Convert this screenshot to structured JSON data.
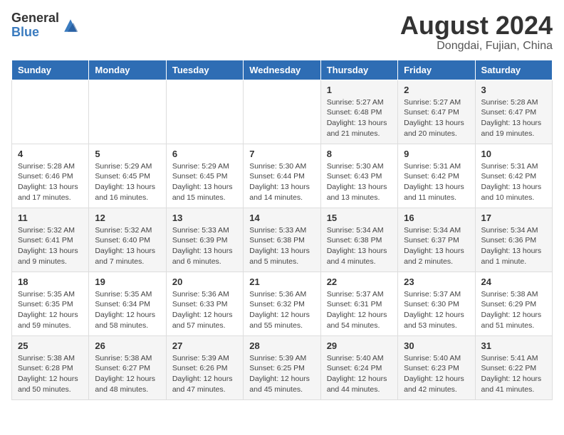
{
  "header": {
    "logo_general": "General",
    "logo_blue": "Blue",
    "month_title": "August 2024",
    "location": "Dongdai, Fujian, China"
  },
  "weekdays": [
    "Sunday",
    "Monday",
    "Tuesday",
    "Wednesday",
    "Thursday",
    "Friday",
    "Saturday"
  ],
  "weeks": [
    [
      {
        "day": "",
        "content": ""
      },
      {
        "day": "",
        "content": ""
      },
      {
        "day": "",
        "content": ""
      },
      {
        "day": "",
        "content": ""
      },
      {
        "day": "1",
        "content": "Sunrise: 5:27 AM\nSunset: 6:48 PM\nDaylight: 13 hours\nand 21 minutes."
      },
      {
        "day": "2",
        "content": "Sunrise: 5:27 AM\nSunset: 6:47 PM\nDaylight: 13 hours\nand 20 minutes."
      },
      {
        "day": "3",
        "content": "Sunrise: 5:28 AM\nSunset: 6:47 PM\nDaylight: 13 hours\nand 19 minutes."
      }
    ],
    [
      {
        "day": "4",
        "content": "Sunrise: 5:28 AM\nSunset: 6:46 PM\nDaylight: 13 hours\nand 17 minutes."
      },
      {
        "day": "5",
        "content": "Sunrise: 5:29 AM\nSunset: 6:45 PM\nDaylight: 13 hours\nand 16 minutes."
      },
      {
        "day": "6",
        "content": "Sunrise: 5:29 AM\nSunset: 6:45 PM\nDaylight: 13 hours\nand 15 minutes."
      },
      {
        "day": "7",
        "content": "Sunrise: 5:30 AM\nSunset: 6:44 PM\nDaylight: 13 hours\nand 14 minutes."
      },
      {
        "day": "8",
        "content": "Sunrise: 5:30 AM\nSunset: 6:43 PM\nDaylight: 13 hours\nand 13 minutes."
      },
      {
        "day": "9",
        "content": "Sunrise: 5:31 AM\nSunset: 6:42 PM\nDaylight: 13 hours\nand 11 minutes."
      },
      {
        "day": "10",
        "content": "Sunrise: 5:31 AM\nSunset: 6:42 PM\nDaylight: 13 hours\nand 10 minutes."
      }
    ],
    [
      {
        "day": "11",
        "content": "Sunrise: 5:32 AM\nSunset: 6:41 PM\nDaylight: 13 hours\nand 9 minutes."
      },
      {
        "day": "12",
        "content": "Sunrise: 5:32 AM\nSunset: 6:40 PM\nDaylight: 13 hours\nand 7 minutes."
      },
      {
        "day": "13",
        "content": "Sunrise: 5:33 AM\nSunset: 6:39 PM\nDaylight: 13 hours\nand 6 minutes."
      },
      {
        "day": "14",
        "content": "Sunrise: 5:33 AM\nSunset: 6:38 PM\nDaylight: 13 hours\nand 5 minutes."
      },
      {
        "day": "15",
        "content": "Sunrise: 5:34 AM\nSunset: 6:38 PM\nDaylight: 13 hours\nand 4 minutes."
      },
      {
        "day": "16",
        "content": "Sunrise: 5:34 AM\nSunset: 6:37 PM\nDaylight: 13 hours\nand 2 minutes."
      },
      {
        "day": "17",
        "content": "Sunrise: 5:34 AM\nSunset: 6:36 PM\nDaylight: 13 hours\nand 1 minute."
      }
    ],
    [
      {
        "day": "18",
        "content": "Sunrise: 5:35 AM\nSunset: 6:35 PM\nDaylight: 12 hours\nand 59 minutes."
      },
      {
        "day": "19",
        "content": "Sunrise: 5:35 AM\nSunset: 6:34 PM\nDaylight: 12 hours\nand 58 minutes."
      },
      {
        "day": "20",
        "content": "Sunrise: 5:36 AM\nSunset: 6:33 PM\nDaylight: 12 hours\nand 57 minutes."
      },
      {
        "day": "21",
        "content": "Sunrise: 5:36 AM\nSunset: 6:32 PM\nDaylight: 12 hours\nand 55 minutes."
      },
      {
        "day": "22",
        "content": "Sunrise: 5:37 AM\nSunset: 6:31 PM\nDaylight: 12 hours\nand 54 minutes."
      },
      {
        "day": "23",
        "content": "Sunrise: 5:37 AM\nSunset: 6:30 PM\nDaylight: 12 hours\nand 53 minutes."
      },
      {
        "day": "24",
        "content": "Sunrise: 5:38 AM\nSunset: 6:29 PM\nDaylight: 12 hours\nand 51 minutes."
      }
    ],
    [
      {
        "day": "25",
        "content": "Sunrise: 5:38 AM\nSunset: 6:28 PM\nDaylight: 12 hours\nand 50 minutes."
      },
      {
        "day": "26",
        "content": "Sunrise: 5:38 AM\nSunset: 6:27 PM\nDaylight: 12 hours\nand 48 minutes."
      },
      {
        "day": "27",
        "content": "Sunrise: 5:39 AM\nSunset: 6:26 PM\nDaylight: 12 hours\nand 47 minutes."
      },
      {
        "day": "28",
        "content": "Sunrise: 5:39 AM\nSunset: 6:25 PM\nDaylight: 12 hours\nand 45 minutes."
      },
      {
        "day": "29",
        "content": "Sunrise: 5:40 AM\nSunset: 6:24 PM\nDaylight: 12 hours\nand 44 minutes."
      },
      {
        "day": "30",
        "content": "Sunrise: 5:40 AM\nSunset: 6:23 PM\nDaylight: 12 hours\nand 42 minutes."
      },
      {
        "day": "31",
        "content": "Sunrise: 5:41 AM\nSunset: 6:22 PM\nDaylight: 12 hours\nand 41 minutes."
      }
    ]
  ]
}
